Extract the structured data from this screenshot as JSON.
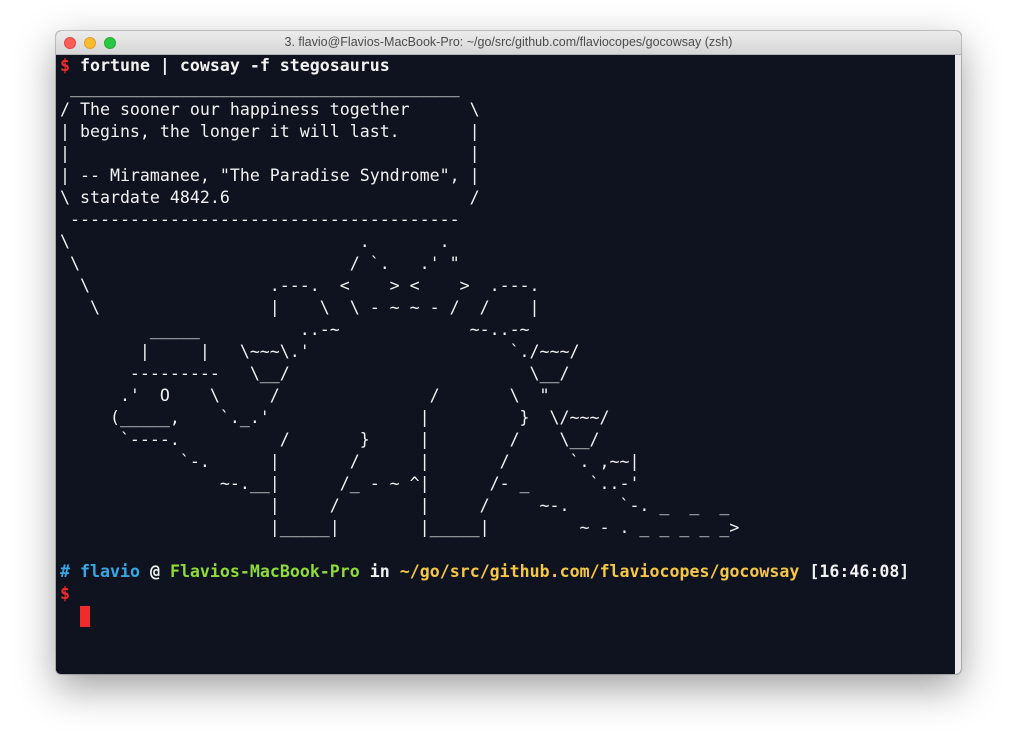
{
  "window": {
    "title": "3. flavio@Flavios-MacBook-Pro: ~/go/src/github.com/flaviocopes/gocowsay (zsh)"
  },
  "command": {
    "prompt_symbol": "$",
    "text": "fortune | cowsay -f stegosaurus"
  },
  "output_lines": [
    " _______________________________________",
    "/ The sooner our happiness together      \\",
    "| begins, the longer it will last.       |",
    "|                                        |",
    "| -- Miramanee, \"The Paradise Syndrome\", |",
    "\\ stardate 4842.6                        /",
    " ---------------------------------------",
    "\\                             .       .",
    " \\                           / `.   .' \"",
    "  \\                  .---.  <    > <    >  .---.",
    "   \\                 |    \\  \\ - ~ ~ - /  /    |",
    "         _____          ..-~             ~-..-~",
    "        |     |   \\~~~\\.'                    `./~~~/",
    "       ---------   \\__/                        \\__/",
    "      .'  O    \\     /               /       \\  \"",
    "     (_____,    `._.'               |         }  \\/~~~/",
    "      `----.          /       }     |        /    \\__/",
    "            `-.      |       /      |       /      `. ,~~|",
    "                ~-.__|      /_ - ~ ^|      /- _      `..-'",
    "                     |     /        |     /     ~-.     `-. _  _  _",
    "                     |_____|        |_____|         ~ - . _ _ _ _ _>"
  ],
  "prompt": {
    "hash": "#",
    "user": "flavio",
    "at": "@",
    "host": "Flavios-MacBook-Pro",
    "in": "in",
    "path": "~/go/src/github.com/flaviocopes/gocowsay",
    "time": "[16:46:08]",
    "prompt_symbol": "$"
  },
  "colors": {
    "background": "#0f1320",
    "prompt_red": "#ef2c2c",
    "user_blue": "#35a8e6",
    "host_green": "#8fdb3a",
    "path_yellow": "#f6c744"
  }
}
